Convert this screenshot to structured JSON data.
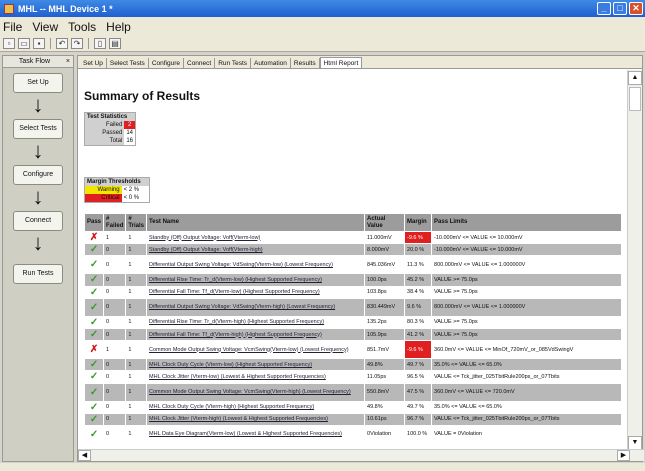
{
  "app": {
    "title": "MHL -- MHL Device 1 *"
  },
  "window_controls": {
    "minimize": "_",
    "maximize": "□",
    "close": "✕"
  },
  "menu": [
    "File",
    "View",
    "Tools",
    "Help"
  ],
  "sidebar": {
    "header": "Task Flow",
    "pin": "×",
    "steps": [
      "Set Up",
      "Select Tests",
      "Configure",
      "Connect",
      "Run Tests"
    ],
    "arrow": "↓"
  },
  "tabs": [
    "Set Up",
    "Select Tests",
    "Configure",
    "Connect",
    "Run Tests",
    "Automation",
    "Results",
    "Html Report"
  ],
  "active_tab": "Html Report",
  "report": {
    "title": "Summary of Results",
    "stats": {
      "header": "Test Statistics",
      "failed_label": "Failed",
      "failed": "2",
      "passed_label": "Passed",
      "passed": "14",
      "total_label": "Total",
      "total": "16"
    },
    "thresholds": {
      "header": "Margin Thresholds",
      "warning_label": "Warning",
      "warning": "< 2 %",
      "critical_label": "Critical",
      "critical": "< 0 %"
    },
    "columns": [
      "Pass",
      "# Failed",
      "# Trials",
      "Test Name",
      "Actual Value",
      "Margin",
      "Pass Limits"
    ],
    "rows": [
      {
        "pass": "✗",
        "status": "fail",
        "failed": "1",
        "trials": "1",
        "name": "Standby (Off) Output Voltage: Voff(Vterm-low)",
        "value": "11.000mV",
        "margin": "-9.6 %",
        "crit": true,
        "limits": "-10.000mV <= VALUE <= 10.000mV",
        "alt": false,
        "dbl": false
      },
      {
        "pass": "✓",
        "status": "pass",
        "failed": "0",
        "trials": "1",
        "name": "Standby (Off) Output Voltage: Voff(Vterm-high)",
        "value": "8.000mV",
        "margin": "20.0 %",
        "crit": false,
        "limits": "-10.000mV <= VALUE <= 10.000mV",
        "alt": true,
        "dbl": false
      },
      {
        "pass": "✓",
        "status": "pass",
        "failed": "0",
        "trials": "1",
        "name": "Differential Output Swing Voltage: VdSwing(Vterm-low) (Lowest Frequency)",
        "value": "845.036mV",
        "margin": "11.3 %",
        "crit": false,
        "limits": "800.000mV <= VALUE <= 1.000000V",
        "alt": false,
        "dbl": true
      },
      {
        "pass": "✓",
        "status": "pass",
        "failed": "0",
        "trials": "1",
        "name": "Differential Rise Time: Tr_d(Vterm-low) (Highest Supported Frequency)",
        "value": "100.0ps",
        "margin": "45.2 %",
        "crit": false,
        "limits": "VALUE >= 75.0ps",
        "alt": true,
        "dbl": false
      },
      {
        "pass": "✓",
        "status": "pass",
        "failed": "0",
        "trials": "1",
        "name": "Differential Fall Time: Tf_d(Vterm-low) (Highest Supported Frequency)",
        "value": "103.8ps",
        "margin": "38.4 %",
        "crit": false,
        "limits": "VALUE >= 75.0ps",
        "alt": false,
        "dbl": false
      },
      {
        "pass": "✓",
        "status": "pass",
        "failed": "0",
        "trials": "1",
        "name": "Differential Output Swing Voltage: VdSwing(Vterm-high) (Lowest Frequency)",
        "value": "830.449mV",
        "margin": "9.6 %",
        "crit": false,
        "limits": "800.000mV <= VALUE <= 1.000000V",
        "alt": true,
        "dbl": true
      },
      {
        "pass": "✓",
        "status": "pass",
        "failed": "0",
        "trials": "1",
        "name": "Differential Rise Time: Tr_d(Vterm-high) (Highest Supported Frequency)",
        "value": "135.2ps",
        "margin": "80.3 %",
        "crit": false,
        "limits": "VALUE >= 75.0ps",
        "alt": false,
        "dbl": false
      },
      {
        "pass": "✓",
        "status": "pass",
        "failed": "0",
        "trials": "1",
        "name": "Differential Fall Time: Tf_d(Vterm-high) (Highest Supported Frequency)",
        "value": "105.9ps",
        "margin": "41.2 %",
        "crit": false,
        "limits": "VALUE >= 75.0ps",
        "alt": true,
        "dbl": false
      },
      {
        "pass": "✗",
        "status": "fail",
        "failed": "1",
        "trials": "1",
        "name": "Common Mode Output Swing Voltage: VcmSwing(Vterm-low) (Lowest Frequency)",
        "value": "851.7mV",
        "margin": "-9.6 %",
        "crit": true,
        "limits": "360.0mV <= VALUE <= MinOf_720mV_or_085VdSwingV",
        "alt": false,
        "dbl": true
      },
      {
        "pass": "✓",
        "status": "pass",
        "failed": "0",
        "trials": "1",
        "name": "MHL Clock Duty Cycle (Vterm-low) (Highest Supported Frequency)",
        "value": "49.8%",
        "margin": "49.7 %",
        "crit": false,
        "limits": "35.0% <= VALUE <= 65.0%",
        "alt": true,
        "dbl": false
      },
      {
        "pass": "✓",
        "status": "pass",
        "failed": "0",
        "trials": "1",
        "name": "MHL Clock Jitter (Vterm-low) (Lowest & Highest Supported Frequencies)",
        "value": "11.05ps",
        "margin": "96.5 %",
        "crit": false,
        "limits": "VALUE <= Tck_jitter_025TbitRule200ps_or_07Tbits",
        "alt": false,
        "dbl": false
      },
      {
        "pass": "✓",
        "status": "pass",
        "failed": "0",
        "trials": "1",
        "name": "Common Mode Output Swing Voltage: VcmSwing(Vterm-high) (Lowest Frequency)",
        "value": "550.8mV",
        "margin": "47.5 %",
        "crit": false,
        "limits": "360.0mV <= VALUE <= 720.0mV",
        "alt": true,
        "dbl": true
      },
      {
        "pass": "✓",
        "status": "pass",
        "failed": "0",
        "trials": "1",
        "name": "MHL Clock Duty Cycle (Vterm-high) (Highest Supported Frequency)",
        "value": "49.8%",
        "margin": "49.7 %",
        "crit": false,
        "limits": "35.0% <= VALUE <= 65.0%",
        "alt": false,
        "dbl": false
      },
      {
        "pass": "✓",
        "status": "pass",
        "failed": "0",
        "trials": "1",
        "name": "MHL Clock Jitter (Vterm-high) (Lowest & Highest Supported Frequencies)",
        "value": "10.61ps",
        "margin": "96.7 %",
        "crit": false,
        "limits": "VALUE <= Tck_jitter_025TbitRule200ps_or_07Tbits",
        "alt": true,
        "dbl": false
      },
      {
        "pass": "✓",
        "status": "pass",
        "failed": "0",
        "trials": "1",
        "name": "MHL Data Eye Diagram(Vterm-low) (Lowest & Highest Supported Frequencies)",
        "value": "0Violation",
        "margin": "100.0 %",
        "crit": false,
        "limits": "VALUE = 0Violation",
        "alt": false,
        "dbl": true
      }
    ]
  },
  "scroll": {
    "up": "▲",
    "down": "▼",
    "left": "◀",
    "right": "▶"
  }
}
